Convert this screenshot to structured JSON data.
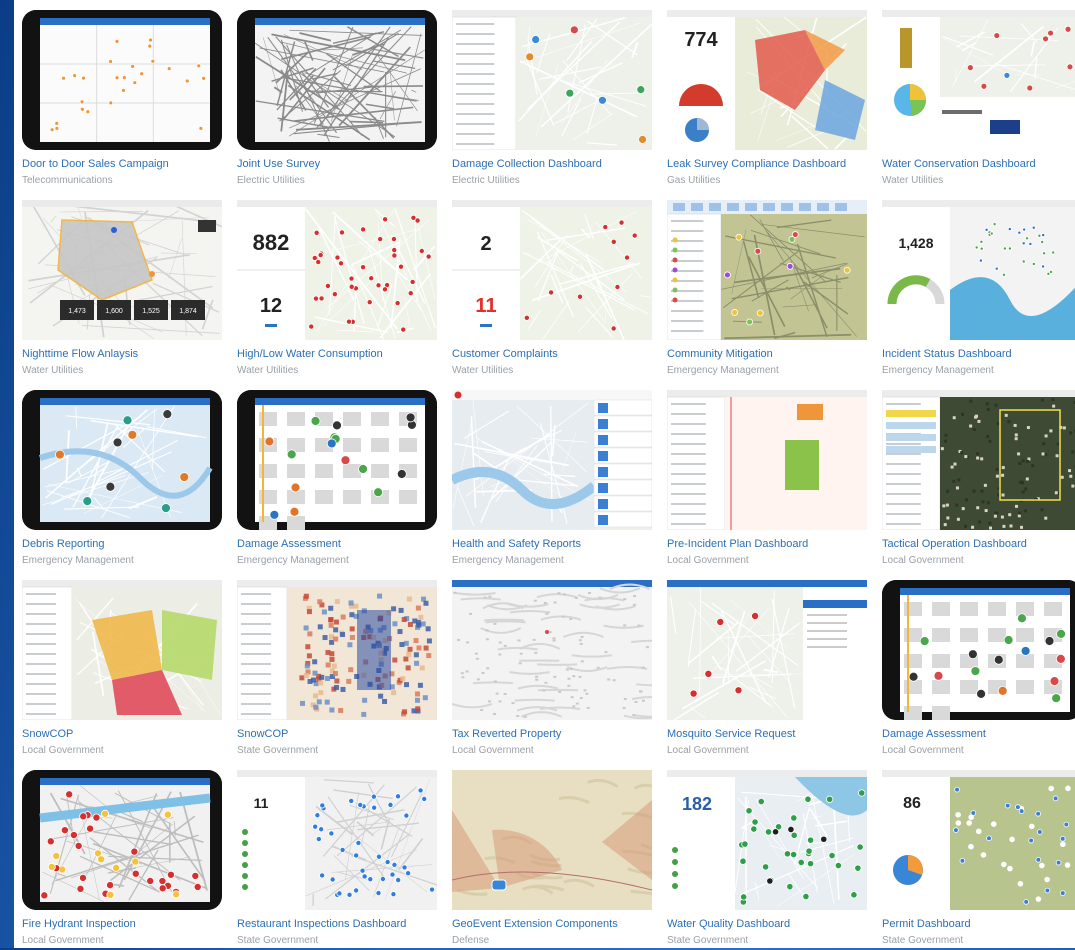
{
  "items": [
    {
      "title": "Door to Door Sales Campaign",
      "category": "Telecommunications",
      "thumb": "tablet-grid",
      "icon": "map-grid-icon"
    },
    {
      "title": "Joint Use Survey",
      "category": "Electric Utilities",
      "thumb": "tablet-streets",
      "icon": "street-map-icon"
    },
    {
      "title": "Damage Collection Dashboard",
      "category": "Electric Utilities",
      "thumb": "dash-list-map",
      "icon": "dashboard-icon"
    },
    {
      "title": "Leak Survey Compliance Dashboard",
      "category": "Gas Utilities",
      "thumb": "dash-kpi-choropleth",
      "big": "774",
      "icon": "dashboard-icon"
    },
    {
      "title": "Water Conservation Dashboard",
      "category": "Water Utilities",
      "thumb": "dash-charts",
      "icon": "dashboard-icon"
    },
    {
      "title": "Nighttime Flow Anlaysis",
      "category": "Water Utilities",
      "thumb": "map-polygon-stats",
      "icon": "map-icon",
      "stats": [
        "1,473",
        "1,600",
        "1,525",
        "1,874"
      ]
    },
    {
      "title": "High/Low Water Consumption",
      "category": "Water Utilities",
      "thumb": "dash-two-kpi",
      "big": "882",
      "big2": "12",
      "icon": "dashboard-icon"
    },
    {
      "title": "Customer Complaints",
      "category": "Water Utilities",
      "thumb": "dash-two-kpi-red",
      "big": "2",
      "big2": "11",
      "icon": "dashboard-icon"
    },
    {
      "title": "Community Mitigation",
      "category": "Emergency Management",
      "thumb": "desktop-map",
      "icon": "desktop-app-icon"
    },
    {
      "title": "Incident Status Dashboard",
      "category": "Emergency Management",
      "thumb": "dash-kpi-coast",
      "big": "1,428",
      "icon": "dashboard-icon"
    },
    {
      "title": "Debris Reporting",
      "category": "Emergency Management",
      "thumb": "tablet-map-markers",
      "icon": "tablet-map-icon"
    },
    {
      "title": "Damage Assessment",
      "category": "Emergency Management",
      "thumb": "tablet-parcels",
      "icon": "tablet-map-icon"
    },
    {
      "title": "Health and Safety Reports",
      "category": "Emergency Management",
      "thumb": "map-side-icons",
      "icon": "map-icon"
    },
    {
      "title": "Pre-Incident Plan Dashboard",
      "category": "Local Government",
      "thumb": "dash-floorplan",
      "icon": "dashboard-icon"
    },
    {
      "title": "Tactical Operation Dashboard",
      "category": "Local Government",
      "thumb": "dash-aerial",
      "icon": "dashboard-icon"
    },
    {
      "title": "SnowCOP",
      "category": "Local Government",
      "thumb": "dash-zones",
      "icon": "dashboard-icon"
    },
    {
      "title": "SnowCOP",
      "category": "State Government",
      "thumb": "dash-heatmap",
      "icon": "dashboard-icon"
    },
    {
      "title": "Tax Reverted Property",
      "category": "Local Government",
      "thumb": "map-parcels-light",
      "icon": "map-icon"
    },
    {
      "title": "Mosquito Service Request",
      "category": "Local Government",
      "thumb": "map-form-panel",
      "icon": "form-icon"
    },
    {
      "title": "Damage Assessment",
      "category": "Local Government",
      "thumb": "tablet-parcels",
      "icon": "tablet-map-icon"
    },
    {
      "title": "Fire Hydrant Inspection",
      "category": "Local Government",
      "thumb": "tablet-hydrants",
      "icon": "tablet-map-icon"
    },
    {
      "title": "Restaurant Inspections Dashboard",
      "category": "State Government",
      "thumb": "dash-kpi-bluepins",
      "big": "11",
      "icon": "dashboard-icon"
    },
    {
      "title": "GeoEvent Extension Components",
      "category": "Defense",
      "thumb": "map-terrain-sectors",
      "icon": "map-icon"
    },
    {
      "title": "Water Quality Dashboard",
      "category": "State Government",
      "thumb": "dash-kpi-greenpins",
      "big": "182",
      "icon": "dashboard-icon"
    },
    {
      "title": "Permit Dashboard",
      "category": "State Government",
      "thumb": "dash-kpi-terrain",
      "big": "86",
      "icon": "dashboard-icon"
    }
  ],
  "colors": {
    "link": "#2c6fb5",
    "category": "#9aa0a6",
    "background": "#1f5fb4"
  }
}
